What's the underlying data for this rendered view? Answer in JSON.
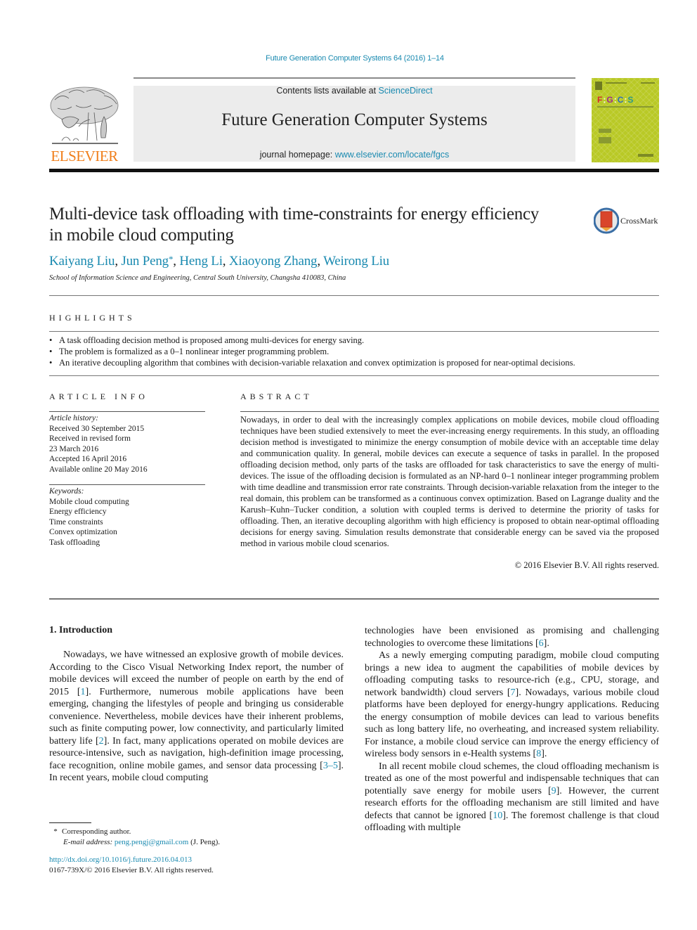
{
  "header": {
    "journal_ref": "Future Generation Computer Systems 64 (2016) 1–14",
    "contents_prefix": "Contents lists available at ",
    "contents_link": "ScienceDirect",
    "journal_title": "Future Generation Computer Systems",
    "homepage_prefix": "journal homepage: ",
    "homepage_link": "www.elsevier.com/locate/fgcs",
    "publisher_logo": "ELSEVIER",
    "cover_title": "F|G|C|S",
    "colors": {
      "link": "#1a8ab0",
      "elsevier_orange": "#f07e1a",
      "cover_green": "#b9c926"
    }
  },
  "article": {
    "title": "Multi-device task offloading with time-constraints for energy efficiency in mobile cloud computing",
    "crossmark_label": "CrossMark",
    "authors": [
      {
        "name": "Kaiyang Liu",
        "mark": ""
      },
      {
        "name": "Jun Peng",
        "mark": "*"
      },
      {
        "name": "Heng Li",
        "mark": ""
      },
      {
        "name": "Xiaoyong Zhang",
        "mark": ""
      },
      {
        "name": "Weirong Liu",
        "mark": ""
      }
    ],
    "affiliation": "School of Information Science and Engineering, Central South University, Changsha 410083, China"
  },
  "highlights": {
    "heading": "HIGHLIGHTS",
    "items": [
      "A task offloading decision method is proposed among multi-devices for energy saving.",
      "The problem is formalized as a 0–1 nonlinear integer programming problem.",
      "An iterative decoupling algorithm that combines with decision-variable relaxation and convex optimization is proposed for near-optimal decisions."
    ]
  },
  "article_info": {
    "heading": "ARTICLE INFO",
    "history_label": "Article history:",
    "history": [
      "Received 30 September 2015",
      "Received in revised form",
      "23 March 2016",
      "Accepted 16 April 2016",
      "Available online 20 May 2016"
    ],
    "keywords_label": "Keywords:",
    "keywords": [
      "Mobile cloud computing",
      "Energy efficiency",
      "Time constraints",
      "Convex optimization",
      "Task offloading"
    ]
  },
  "abstract": {
    "heading": "ABSTRACT",
    "text": "Nowadays, in order to deal with the increasingly complex applications on mobile devices, mobile cloud offloading techniques have been studied extensively to meet the ever-increasing energy requirements. In this study, an offloading decision method is investigated to minimize the energy consumption of mobile device with an acceptable time delay and communication quality. In general, mobile devices can execute a sequence of tasks in parallel. In the proposed offloading decision method, only parts of the tasks are offloaded for task characteristics to save the energy of multi-devices. The issue of the offloading decision is formulated as an NP-hard 0–1 nonlinear integer programming problem with time deadline and transmission error rate constraints. Through decision-variable relaxation from the integer to the real domain, this problem can be transformed as a continuous convex optimization. Based on Lagrange duality and the Karush–Kuhn–Tucker condition, a solution with coupled terms is derived to determine the priority of tasks for offloading. Then, an iterative decoupling algorithm with high efficiency is proposed to obtain near-optimal offloading decisions for energy saving. Simulation results demonstrate that considerable energy can be saved via the proposed method in various mobile cloud scenarios.",
    "copyright": "© 2016 Elsevier B.V. All rights reserved."
  },
  "body": {
    "section_heading": "1.  Introduction",
    "left_paragraphs": [
      [
        {
          "t": "Nowadays, we have witnessed an explosive growth of mobile devices. According to the Cisco Visual Networking Index report, the number of mobile devices will exceed the number of people on earth by the end of 2015 ["
        },
        {
          "ref": "1"
        },
        {
          "t": "]. Furthermore, numerous mobile applications have been emerging, changing the lifestyles of people and bringing us considerable convenience. Nevertheless, mobile devices have their inherent problems, such as finite computing power, low connectivity, and particularly limited battery life ["
        },
        {
          "ref": "2"
        },
        {
          "t": "]. In fact, many applications operated on mobile devices are resource-intensive, such as navigation, high-definition image processing, face recognition, online mobile games, and sensor data processing ["
        },
        {
          "ref": "3–5"
        },
        {
          "t": "]. In recent years, mobile cloud computing"
        }
      ]
    ],
    "right_paragraphs": [
      [
        {
          "t": "technologies have been envisioned as promising and challenging technologies to overcome these limitations ["
        },
        {
          "ref": "6"
        },
        {
          "t": "]."
        }
      ],
      [
        {
          "t": "As a newly emerging computing paradigm, mobile cloud computing brings a new idea to augment the capabilities of mobile devices by offloading computing tasks to resource-rich (e.g., CPU, storage, and network bandwidth) cloud servers ["
        },
        {
          "ref": "7"
        },
        {
          "t": "]. Nowadays, various mobile cloud platforms have been deployed for energy-hungry applications. Reducing the energy consumption of mobile devices can lead to various benefits such as long battery life, no overheating, and increased system reliability. For instance, a mobile cloud service can improve the energy efficiency of wireless body sensors in e-Health systems ["
        },
        {
          "ref": "8"
        },
        {
          "t": "]."
        }
      ],
      [
        {
          "t": "In all recent mobile cloud schemes, the cloud offloading mechanism is treated as one of the most powerful and indispensable techniques that can potentially save energy for mobile users ["
        },
        {
          "ref": "9"
        },
        {
          "t": "]. However, the current research efforts for the offloading mechanism are still limited and have defects that cannot be ignored ["
        },
        {
          "ref": "10"
        },
        {
          "t": "]. The foremost challenge is that cloud offloading with multiple"
        }
      ]
    ]
  },
  "footnotes": {
    "star": "*",
    "corresponding": "Corresponding author.",
    "email_label": "E-mail address:",
    "email": "peng.pengj@gmail.com",
    "email_suffix": " (J. Peng).",
    "doi": "http://dx.doi.org/10.1016/j.future.2016.04.013",
    "issn": "0167-739X/© 2016 Elsevier B.V. All rights reserved."
  }
}
